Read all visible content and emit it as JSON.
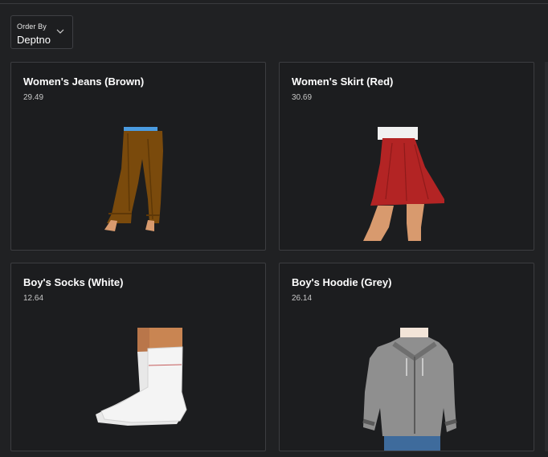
{
  "toolbar": {
    "order_by_label": "Order By",
    "order_by_value": "Deptno",
    "dropdown_icon": "chevron-down-icon"
  },
  "products": [
    {
      "title": "Women's Jeans (Brown)",
      "price": "29.49",
      "image": "womens-jeans-brown-image"
    },
    {
      "title": "Women's Skirt (Red)",
      "price": "30.69",
      "image": "womens-skirt-red-image"
    },
    {
      "title": "Boy's Socks (White)",
      "price": "12.64",
      "image": "boys-socks-white-image"
    },
    {
      "title": "Boy's Hoodie (Grey)",
      "price": "26.14",
      "image": "boys-hoodie-grey-image"
    }
  ],
  "colors": {
    "background": "#202123",
    "card": "#1c1d1f",
    "card_border": "#3c3d40",
    "jeans": "#7a4a0c",
    "skirt": "#b32424",
    "hoodie": "#8f8f8f"
  }
}
